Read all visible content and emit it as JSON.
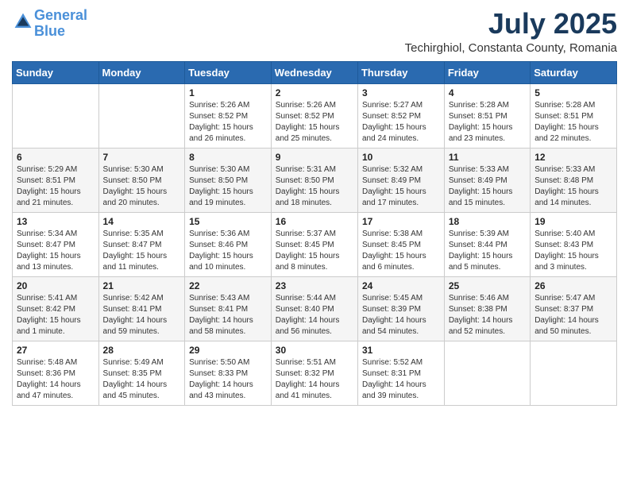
{
  "header": {
    "logo_line1": "General",
    "logo_line2": "Blue",
    "month_year": "July 2025",
    "location": "Techirghiol, Constanta County, Romania"
  },
  "days_of_week": [
    "Sunday",
    "Monday",
    "Tuesday",
    "Wednesday",
    "Thursday",
    "Friday",
    "Saturday"
  ],
  "weeks": [
    [
      {
        "day": "",
        "content": ""
      },
      {
        "day": "",
        "content": ""
      },
      {
        "day": "1",
        "content": "Sunrise: 5:26 AM\nSunset: 8:52 PM\nDaylight: 15 hours and 26 minutes."
      },
      {
        "day": "2",
        "content": "Sunrise: 5:26 AM\nSunset: 8:52 PM\nDaylight: 15 hours and 25 minutes."
      },
      {
        "day": "3",
        "content": "Sunrise: 5:27 AM\nSunset: 8:52 PM\nDaylight: 15 hours and 24 minutes."
      },
      {
        "day": "4",
        "content": "Sunrise: 5:28 AM\nSunset: 8:51 PM\nDaylight: 15 hours and 23 minutes."
      },
      {
        "day": "5",
        "content": "Sunrise: 5:28 AM\nSunset: 8:51 PM\nDaylight: 15 hours and 22 minutes."
      }
    ],
    [
      {
        "day": "6",
        "content": "Sunrise: 5:29 AM\nSunset: 8:51 PM\nDaylight: 15 hours and 21 minutes."
      },
      {
        "day": "7",
        "content": "Sunrise: 5:30 AM\nSunset: 8:50 PM\nDaylight: 15 hours and 20 minutes."
      },
      {
        "day": "8",
        "content": "Sunrise: 5:30 AM\nSunset: 8:50 PM\nDaylight: 15 hours and 19 minutes."
      },
      {
        "day": "9",
        "content": "Sunrise: 5:31 AM\nSunset: 8:50 PM\nDaylight: 15 hours and 18 minutes."
      },
      {
        "day": "10",
        "content": "Sunrise: 5:32 AM\nSunset: 8:49 PM\nDaylight: 15 hours and 17 minutes."
      },
      {
        "day": "11",
        "content": "Sunrise: 5:33 AM\nSunset: 8:49 PM\nDaylight: 15 hours and 15 minutes."
      },
      {
        "day": "12",
        "content": "Sunrise: 5:33 AM\nSunset: 8:48 PM\nDaylight: 15 hours and 14 minutes."
      }
    ],
    [
      {
        "day": "13",
        "content": "Sunrise: 5:34 AM\nSunset: 8:47 PM\nDaylight: 15 hours and 13 minutes."
      },
      {
        "day": "14",
        "content": "Sunrise: 5:35 AM\nSunset: 8:47 PM\nDaylight: 15 hours and 11 minutes."
      },
      {
        "day": "15",
        "content": "Sunrise: 5:36 AM\nSunset: 8:46 PM\nDaylight: 15 hours and 10 minutes."
      },
      {
        "day": "16",
        "content": "Sunrise: 5:37 AM\nSunset: 8:45 PM\nDaylight: 15 hours and 8 minutes."
      },
      {
        "day": "17",
        "content": "Sunrise: 5:38 AM\nSunset: 8:45 PM\nDaylight: 15 hours and 6 minutes."
      },
      {
        "day": "18",
        "content": "Sunrise: 5:39 AM\nSunset: 8:44 PM\nDaylight: 15 hours and 5 minutes."
      },
      {
        "day": "19",
        "content": "Sunrise: 5:40 AM\nSunset: 8:43 PM\nDaylight: 15 hours and 3 minutes."
      }
    ],
    [
      {
        "day": "20",
        "content": "Sunrise: 5:41 AM\nSunset: 8:42 PM\nDaylight: 15 hours and 1 minute."
      },
      {
        "day": "21",
        "content": "Sunrise: 5:42 AM\nSunset: 8:41 PM\nDaylight: 14 hours and 59 minutes."
      },
      {
        "day": "22",
        "content": "Sunrise: 5:43 AM\nSunset: 8:41 PM\nDaylight: 14 hours and 58 minutes."
      },
      {
        "day": "23",
        "content": "Sunrise: 5:44 AM\nSunset: 8:40 PM\nDaylight: 14 hours and 56 minutes."
      },
      {
        "day": "24",
        "content": "Sunrise: 5:45 AM\nSunset: 8:39 PM\nDaylight: 14 hours and 54 minutes."
      },
      {
        "day": "25",
        "content": "Sunrise: 5:46 AM\nSunset: 8:38 PM\nDaylight: 14 hours and 52 minutes."
      },
      {
        "day": "26",
        "content": "Sunrise: 5:47 AM\nSunset: 8:37 PM\nDaylight: 14 hours and 50 minutes."
      }
    ],
    [
      {
        "day": "27",
        "content": "Sunrise: 5:48 AM\nSunset: 8:36 PM\nDaylight: 14 hours and 47 minutes."
      },
      {
        "day": "28",
        "content": "Sunrise: 5:49 AM\nSunset: 8:35 PM\nDaylight: 14 hours and 45 minutes."
      },
      {
        "day": "29",
        "content": "Sunrise: 5:50 AM\nSunset: 8:33 PM\nDaylight: 14 hours and 43 minutes."
      },
      {
        "day": "30",
        "content": "Sunrise: 5:51 AM\nSunset: 8:32 PM\nDaylight: 14 hours and 41 minutes."
      },
      {
        "day": "31",
        "content": "Sunrise: 5:52 AM\nSunset: 8:31 PM\nDaylight: 14 hours and 39 minutes."
      },
      {
        "day": "",
        "content": ""
      },
      {
        "day": "",
        "content": ""
      }
    ]
  ]
}
